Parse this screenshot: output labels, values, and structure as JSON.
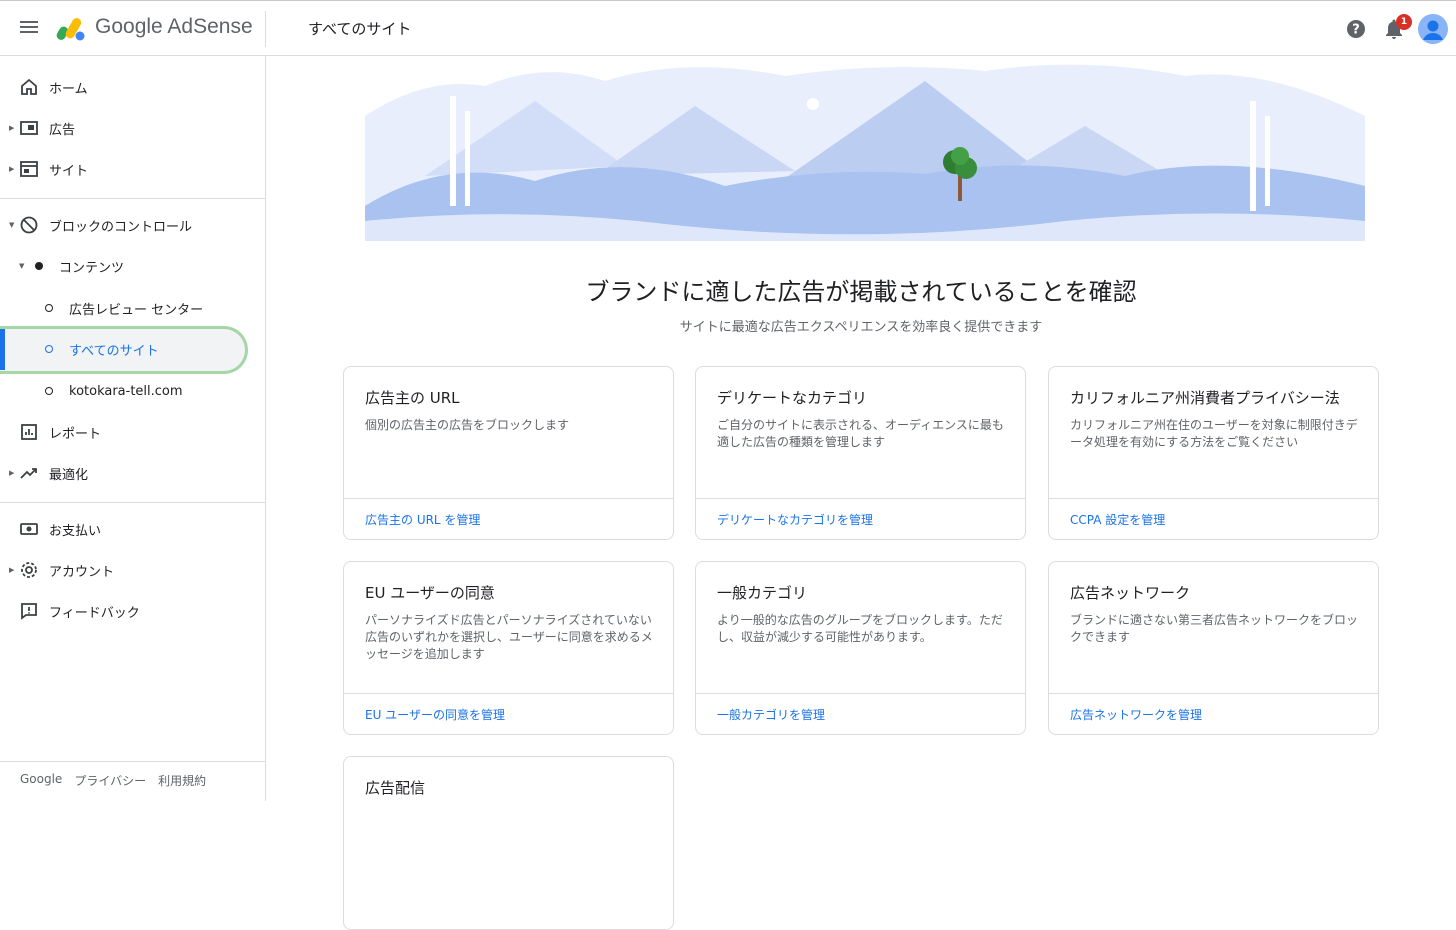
{
  "header": {
    "app_name": "Google AdSense",
    "page_title": "すべてのサイト",
    "notification_count": "1"
  },
  "sidebar": {
    "items": [
      {
        "label": "ホーム"
      },
      {
        "label": "広告"
      },
      {
        "label": "サイト"
      },
      {
        "label": "ブロックのコントロール"
      },
      {
        "label": "コンテンツ"
      },
      {
        "label": "広告レビュー センター"
      },
      {
        "label": "すべてのサイト"
      },
      {
        "label": "kotokara-tell.com"
      },
      {
        "label": "レポート"
      },
      {
        "label": "最適化"
      },
      {
        "label": "お支払い"
      },
      {
        "label": "アカウント"
      },
      {
        "label": "フィードバック"
      }
    ],
    "footer": {
      "google": "Google",
      "privacy": "プライバシー",
      "terms": "利用規約"
    }
  },
  "main": {
    "heading": "ブランドに適した広告が掲載されていることを確認",
    "subheading": "サイトに最適な広告エクスペリエンスを効率良く提供できます",
    "cards": [
      {
        "title": "広告主の URL",
        "desc": "個別の広告主の広告をブロックします",
        "link": "広告主の URL を管理"
      },
      {
        "title": "デリケートなカテゴリ",
        "desc": "ご自分のサイトに表示される、オーディエンスに最も適した広告の種類を管理します",
        "link": "デリケートなカテゴリを管理"
      },
      {
        "title": "カリフォルニア州消費者プライバシー法",
        "desc": "カリフォルニア州在住のユーザーを対象に制限付きデータ処理を有効にする方法をご覧ください",
        "link": "CCPA 設定を管理"
      },
      {
        "title": "EU ユーザーの同意",
        "desc": "パーソナライズド広告とパーソナライズされていない広告のいずれかを選択し、ユーザーに同意を求めるメッセージを追加します",
        "link": "EU ユーザーの同意を管理"
      },
      {
        "title": "一般カテゴリ",
        "desc": "より一般的な広告のグループをブロックします。ただし、収益が減少する可能性があります。",
        "link": "一般カテゴリを管理"
      },
      {
        "title": "広告ネットワーク",
        "desc": "ブランドに適さない第三者広告ネットワークをブロックできます",
        "link": "広告ネットワークを管理"
      },
      {
        "title": "広告配信",
        "desc": "",
        "link": ""
      }
    ]
  },
  "colors": {
    "accent": "#1a73e8",
    "active_outline": "#a5d6a7",
    "badge": "#d93025"
  }
}
